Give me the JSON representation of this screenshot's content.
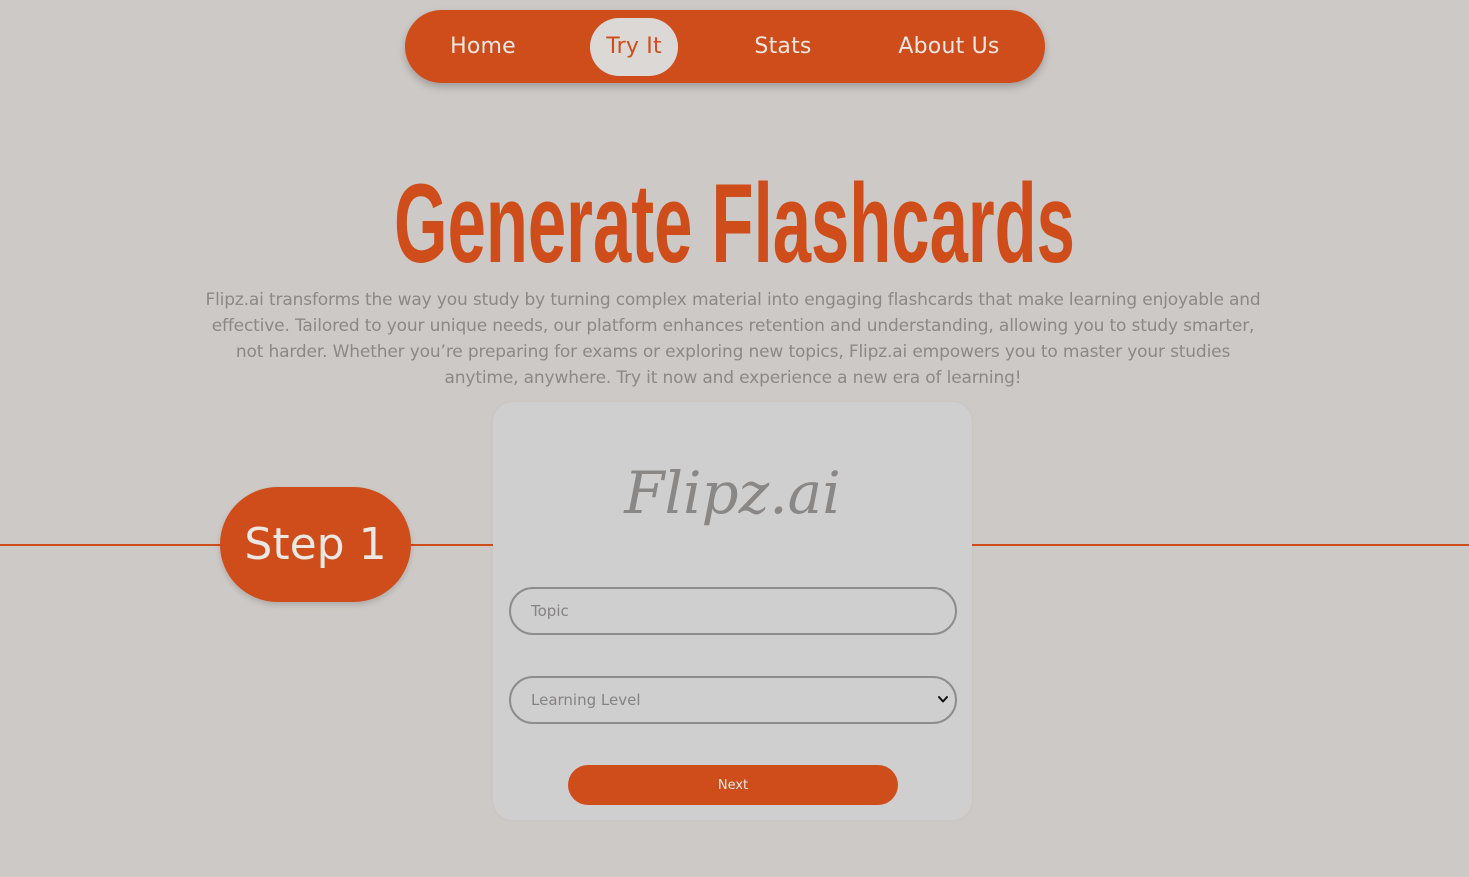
{
  "nav": {
    "items": [
      {
        "label": "Home"
      },
      {
        "label": "Try It",
        "active": true
      },
      {
        "label": "Stats"
      },
      {
        "label": "About Us"
      }
    ]
  },
  "hero": {
    "title": "Generate Flashcards",
    "description": "Flipz.ai transforms the way you study by turning complex material into engaging flashcards that make learning enjoyable and effective. Tailored to your unique needs, our platform enhances retention and understanding, allowing you to study smarter, not harder. Whether you’re preparing for exams or exploring new topics, Flipz.ai empowers you to master your studies anytime, anywhere. Try it now and experience a new era of learning!"
  },
  "step": {
    "label": "Step 1"
  },
  "card": {
    "brand": "Flipz.ai",
    "topic_placeholder": "Topic",
    "level_selected": "Learning Level",
    "next_label": "Next"
  },
  "colors": {
    "accent": "#cf4d1a",
    "background": "#cdc9c6",
    "card": "#cfcfd0",
    "muted_text": "#8b8886"
  },
  "icons": {
    "select_chevron": "chevron-down-icon"
  }
}
